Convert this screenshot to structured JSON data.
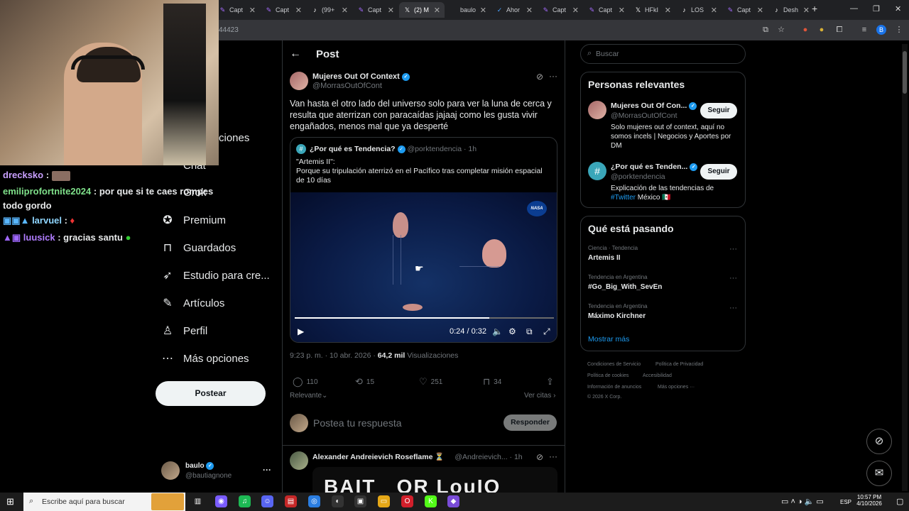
{
  "browser": {
    "tabs": [
      {
        "label": "Capt",
        "icon": "pen-icon",
        "color": "#a66cff"
      },
      {
        "label": "Capt",
        "icon": "pen-icon",
        "color": "#a66cff"
      },
      {
        "label": "(99+",
        "icon": "tiktok-icon",
        "color": "#ffffff"
      },
      {
        "label": "Capt",
        "icon": "pen-icon",
        "color": "#a66cff"
      },
      {
        "label": "(2) M",
        "icon": "x-icon",
        "color": "#ffffff",
        "active": true
      },
      {
        "label": "baulo",
        "icon": "blank-icon",
        "color": "#000000"
      },
      {
        "label": "Ahor",
        "icon": "check-icon",
        "color": "#4aa3ff"
      },
      {
        "label": "Capt",
        "icon": "pen-icon",
        "color": "#a66cff"
      },
      {
        "label": "Capt",
        "icon": "pen-icon",
        "color": "#a66cff"
      },
      {
        "label": "HFkI",
        "icon": "x-icon",
        "color": "#ffffff"
      },
      {
        "label": "LOS",
        "icon": "tiktok-icon",
        "color": "#ffffff"
      },
      {
        "label": "Capt",
        "icon": "pen-icon",
        "color": "#a66cff"
      },
      {
        "label": "Desh",
        "icon": "tiktok-icon",
        "color": "#ffffff"
      }
    ],
    "new_tab": "+",
    "url_fragment": "44423",
    "profile_initial": "B"
  },
  "stream": {
    "chat": [
      {
        "user": "drecksko",
        "color": "#c9a0ff",
        "message": ""
      },
      {
        "user": "emiliprofortnite2024",
        "color": "#7fe08a",
        "message": "por que si te caes rompes todo gordo"
      },
      {
        "user": "larvuel",
        "color": "#8fd6ff",
        "message": ""
      },
      {
        "user": "luusick",
        "color": "#b07cff",
        "message": "gracias santu"
      }
    ]
  },
  "nav": {
    "partial_top": "ciones",
    "partial_chat": "Chat",
    "partial_grok": "Grok",
    "items": [
      {
        "label": "Premium",
        "icon": "premium-icon"
      },
      {
        "label": "Guardados",
        "icon": "bookmark-icon"
      },
      {
        "label": "Estudio para cre...",
        "icon": "rocket-icon"
      },
      {
        "label": "Artículos",
        "icon": "articles-icon"
      },
      {
        "label": "Perfil",
        "icon": "person-icon"
      },
      {
        "label": "Más opciones",
        "icon": "more-circle-icon"
      }
    ],
    "post_button": "Postear",
    "account": {
      "name": "baulo",
      "handle": "@bautiagnone"
    }
  },
  "post": {
    "header": "Post",
    "author": {
      "name": "Mujeres Out Of Context",
      "handle": "@MorrasOutOfCont"
    },
    "text": "Van hasta el otro lado del universo solo para ver la luna de cerca y resulta que aterrizan con paracaídas jajaaj como les gusta vivir engañados, menos mal que ya desperté",
    "quote": {
      "name": "¿Por qué es Tendencia?",
      "handle": "@porktendencia",
      "time": "· 1h",
      "title": "\"Artemis II\":",
      "body": "Porque su tripulación aterrizó en el Pacífico tras completar misión espacial de 10 días",
      "video_time": "0:24 / 0:32",
      "progress": 0.75,
      "watermark": "NASA"
    },
    "meta_time": "9:23 p. m. · 10 abr. 2026 ·",
    "views_count": "64,2 mil",
    "views_label": "Visualizaciones",
    "stats": {
      "replies": "110",
      "reposts": "15",
      "likes": "251",
      "bookmarks": "34"
    },
    "sort_label": "Relevante",
    "quotes_link": "Ver citas",
    "reply_placeholder": "Postea tu respuesta",
    "reply_button": "Responder"
  },
  "next_post": {
    "name": "Alexander Andreievich Roseflame ⏳",
    "handle": "@Andreievich...",
    "time": "· 1h",
    "image_text": "BAIT   OR LouIO"
  },
  "sidebar": {
    "search_placeholder": "Buscar",
    "relevant_title": "Personas relevantes",
    "people": [
      {
        "name": "Mujeres Out Of Con...",
        "handle": "@MorrasOutOfCont",
        "bio": "Solo mujeres out of context, aquí no somos incels | Negocios y Aportes por DM",
        "button": "Seguir"
      },
      {
        "name": "¿Por qué es Tenden...",
        "handle": "@porktendencia",
        "bio_pre": "Explicación de las tendencias de ",
        "bio_link": "#Twitter",
        "bio_post": " México 🇲🇽",
        "button": "Seguir"
      }
    ],
    "trends_title": "Qué está pasando",
    "trends": [
      {
        "category": "Ciencia · Tendencia",
        "name": "Artemis II"
      },
      {
        "category": "Tendencia en Argentina",
        "name": "#Go_Big_With_SevEn"
      },
      {
        "category": "Tendencia en Argentina",
        "name": "Máximo Kirchner"
      }
    ],
    "show_more": "Mostrar más",
    "footer": [
      "Condiciones de Servicio",
      "Política de Privacidad",
      "Política de cookies",
      "Accesibilidad",
      "Información de anuncios",
      "Más opciones ···",
      "© 2026 X Corp."
    ]
  },
  "taskbar": {
    "search_placeholder": "Escribe aquí para buscar",
    "time": "10:57 PM",
    "date": "4/10/2026",
    "lang": "ESP"
  }
}
